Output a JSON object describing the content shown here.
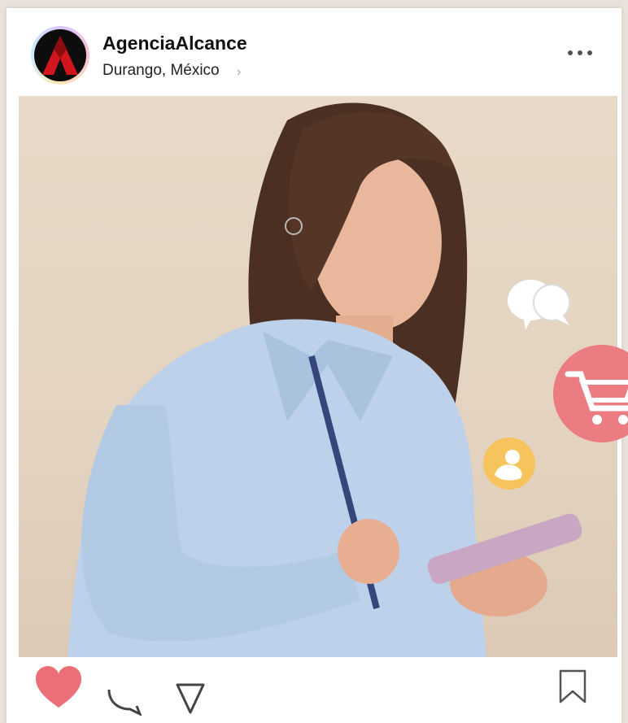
{
  "post": {
    "username": "AgenciaAlcance",
    "location": "Durango, México",
    "location_chevron": "›"
  },
  "icons": {
    "avatar": "agency-logo-icon",
    "more": "more-horizontal-icon",
    "like": "heart-icon",
    "comment": "comment-icon",
    "share": "send-icon",
    "save": "bookmark-icon",
    "floating": [
      "chat-bubbles-icon",
      "shopping-cart-icon",
      "user-icon"
    ]
  },
  "colors": {
    "heart": "#ea6f78",
    "cart_bg": "#eb7c82",
    "user_bg": "#f6c35c",
    "logo_red": "#d0161c",
    "accent_dot": "#ea6a45"
  }
}
